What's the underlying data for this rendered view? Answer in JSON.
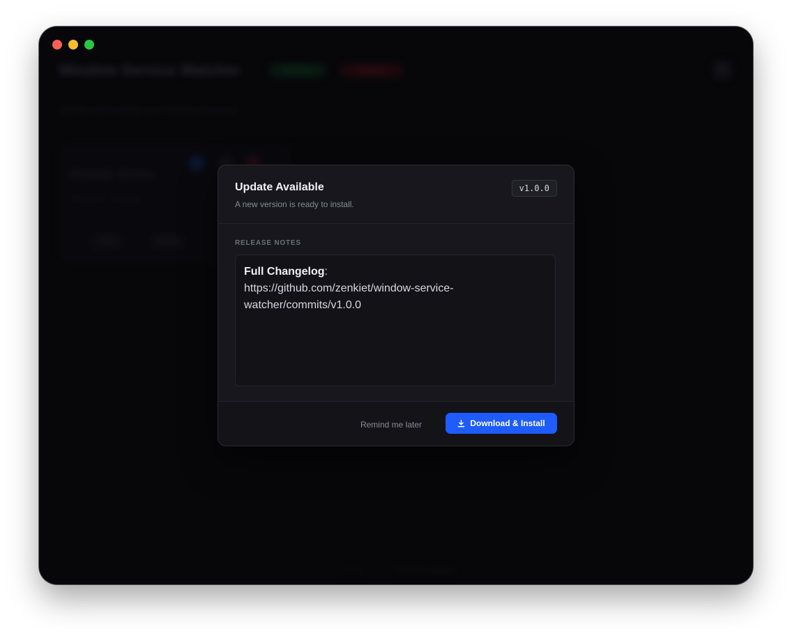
{
  "background_app": {
    "title": "Window Service Watcher",
    "badges": [
      "Running",
      "Stopped"
    ],
    "subtitle": "Monitor and manage your Windows services",
    "card": {
      "name": "Example Service",
      "meta": "Automatic · Running",
      "buttons": [
        "Stop",
        "Restart"
      ]
    },
    "footer": [
      "v1.0.0",
      "Check for updates"
    ],
    "gear_icon": "gear-icon"
  },
  "dialog": {
    "title": "Update Available",
    "subtitle": "A new version is ready to install.",
    "version": "v1.0.0",
    "notes_label": "RELEASE NOTES",
    "notes": {
      "strong": "Full Changelog",
      "colon": ":",
      "link": "https://github.com/zenkiet/window-service-watcher/commits/v1.0.0"
    },
    "remind_label": "Remind me later",
    "install_label": "Download & Install",
    "install_icon": "download-icon",
    "accent_color": "#1e5cff"
  }
}
